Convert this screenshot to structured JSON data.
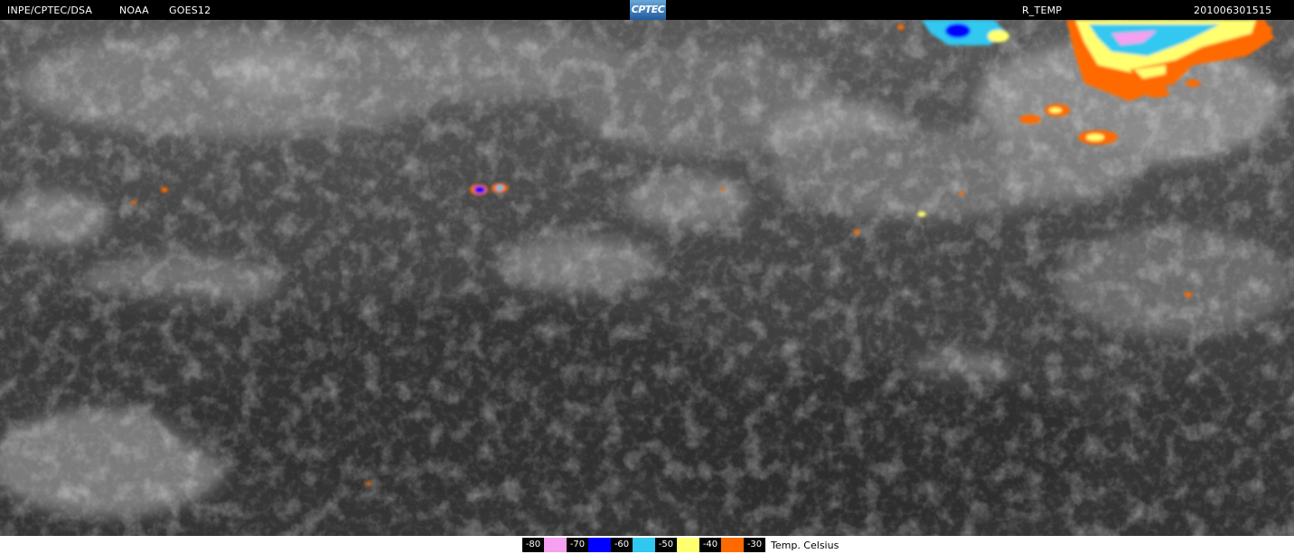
{
  "header": {
    "agency": "INPE/CPTEC/DSA",
    "noaa": "NOAA",
    "satellite": "GOES12",
    "logo_text": "CPTEC",
    "product": "R_TEMP",
    "timestamp": "201006301515"
  },
  "legend": {
    "entries": [
      {
        "label": "-80",
        "color": "#f5a0f0"
      },
      {
        "label": "-70",
        "color": "#0000ff"
      },
      {
        "label": "-60",
        "color": "#30c8f0"
      },
      {
        "label": "-50",
        "color": "#ffff70"
      },
      {
        "label": "-40",
        "color": "#ff6a00"
      },
      {
        "label": "-30",
        "color": null
      }
    ],
    "unit": "Temp. Celsius"
  }
}
